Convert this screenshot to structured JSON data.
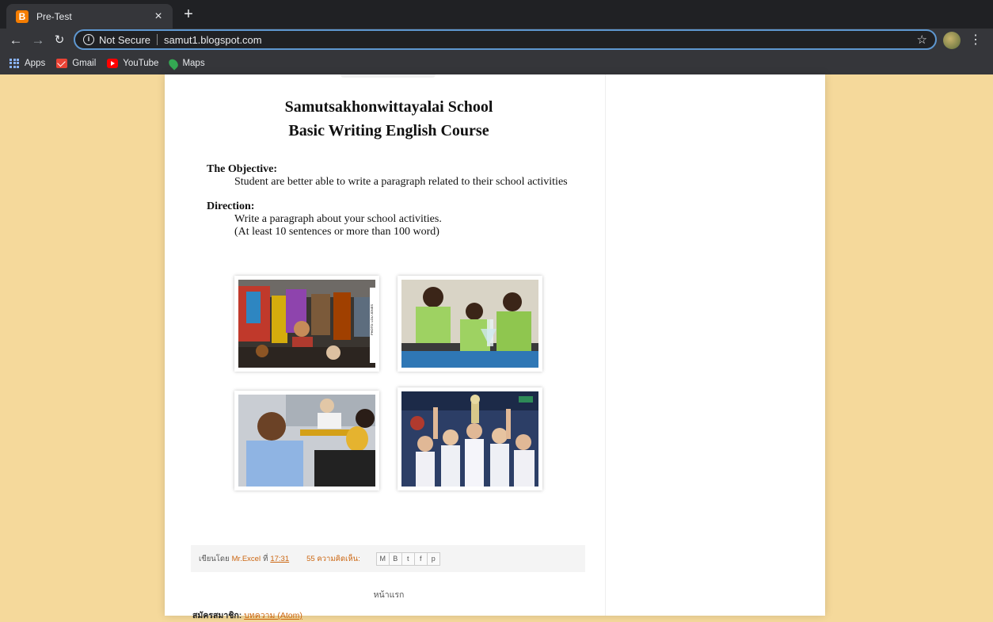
{
  "browser": {
    "tab_title": "Pre-Test",
    "tab_close": "×",
    "new_tab": "+",
    "security_label": "Not Secure",
    "url": "samut1.blogspot.com",
    "bookmarks": [
      {
        "label": "Apps",
        "icon": "apps-icon"
      },
      {
        "label": "Gmail",
        "icon": "gmail-icon"
      },
      {
        "label": "YouTube",
        "icon": "youtube-icon"
      },
      {
        "label": "Maps",
        "icon": "maps-icon"
      }
    ]
  },
  "post": {
    "title_line1": "Samutsakhonwittayalai School",
    "title_line2": "Basic Writing English Course",
    "objective_label": "The Objective:",
    "objective_text": "Student are better able to write a paragraph related to their school activities",
    "direction_label": "Direction:",
    "direction_line1": "Write a paragraph about your school activities.",
    "direction_line2": "(At least 10 sentences or more than 100 word)",
    "photo_credit": "PHOTO: LOU JONES"
  },
  "footer": {
    "posted_by": "เขียนโดย",
    "author": "Mr.Excel",
    "at": "ที่",
    "time": "17:31",
    "comments": "55 ความคิดเห็น:",
    "share_buttons": [
      "M",
      "B",
      "t",
      "f",
      "p"
    ],
    "home": "หน้าแรก",
    "subscribe_label": "สมัครสมาชิก:",
    "subscribe_link": "บทความ (Atom)"
  },
  "colors": {
    "page_bg": "#f5d99b",
    "link": "#cc6611",
    "chrome_dark": "#202124",
    "chrome_mid": "#35363a"
  }
}
